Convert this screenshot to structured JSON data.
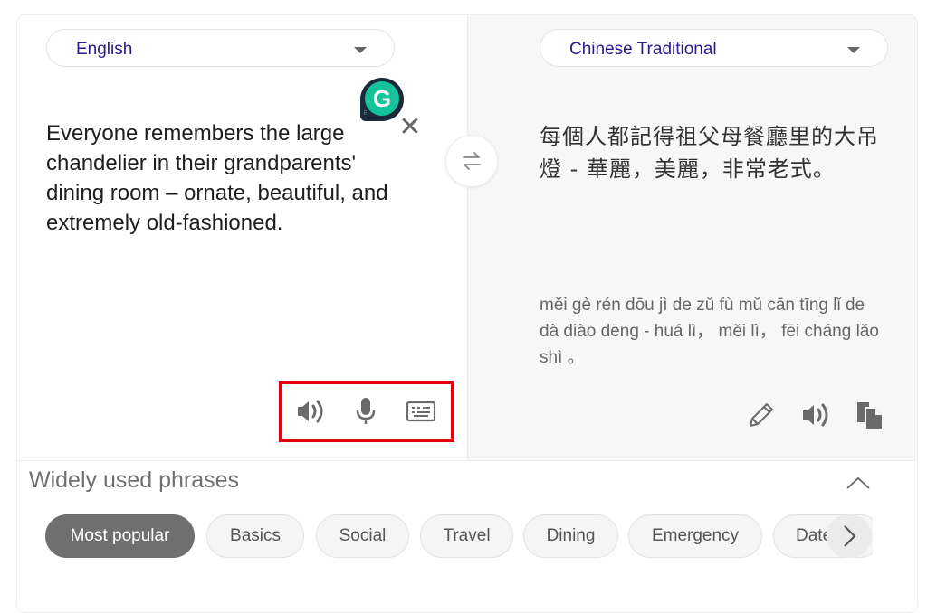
{
  "translator": {
    "source_language": "English",
    "target_language": "Chinese Traditional",
    "source_text": "Everyone remembers the large chandelier in their grandparents' dining room – ornate, beautiful, and extremely old-fashioned.",
    "translated_text": "每個人都記得祖父母餐廳里的大吊燈 - 華麗，美麗，非常老式。",
    "pinyin": "měi gè rén dōu jì de zǔ fù mǔ cān tīng lǐ de dà diào dēng - huá lì，  měi lì，  fēi cháng lǎo shì 。",
    "clear_symbol": "✕",
    "grammarly_letter": "G",
    "source_icons": [
      "speaker-icon",
      "microphone-icon",
      "keyboard-icon"
    ],
    "target_icons": [
      "pencil-icon",
      "speaker-icon",
      "copy-icon"
    ],
    "highlight_color": "#e0000f",
    "accent_color": "#2a1a8f"
  },
  "phrases": {
    "title": "Widely used phrases",
    "categories": [
      {
        "label": "Most popular",
        "active": true
      },
      {
        "label": "Basics",
        "active": false
      },
      {
        "label": "Social",
        "active": false
      },
      {
        "label": "Travel",
        "active": false
      },
      {
        "label": "Dining",
        "active": false
      },
      {
        "label": "Emergency",
        "active": false
      },
      {
        "label": "Dates",
        "active": false
      }
    ]
  }
}
